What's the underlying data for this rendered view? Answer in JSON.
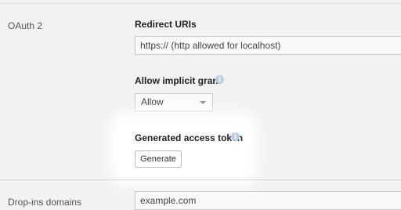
{
  "oauth_section": {
    "label": "OAuth 2",
    "redirect_uris": {
      "label": "Redirect URIs",
      "placeholder": "https:// (http allowed for localhost)"
    },
    "implicit_grant": {
      "label": "Allow implicit grant",
      "selected": "Allow",
      "icon": "info-icon"
    },
    "access_token": {
      "label": "Generated access token",
      "icon": "info-icon",
      "button_label": "Generate"
    }
  },
  "dropins_section": {
    "label": "Drop-ins domains",
    "value": "example.com"
  },
  "colors": {
    "background": "#f2f2f2",
    "highlight": "#ffffff",
    "info_icon": "#b9cde6"
  }
}
